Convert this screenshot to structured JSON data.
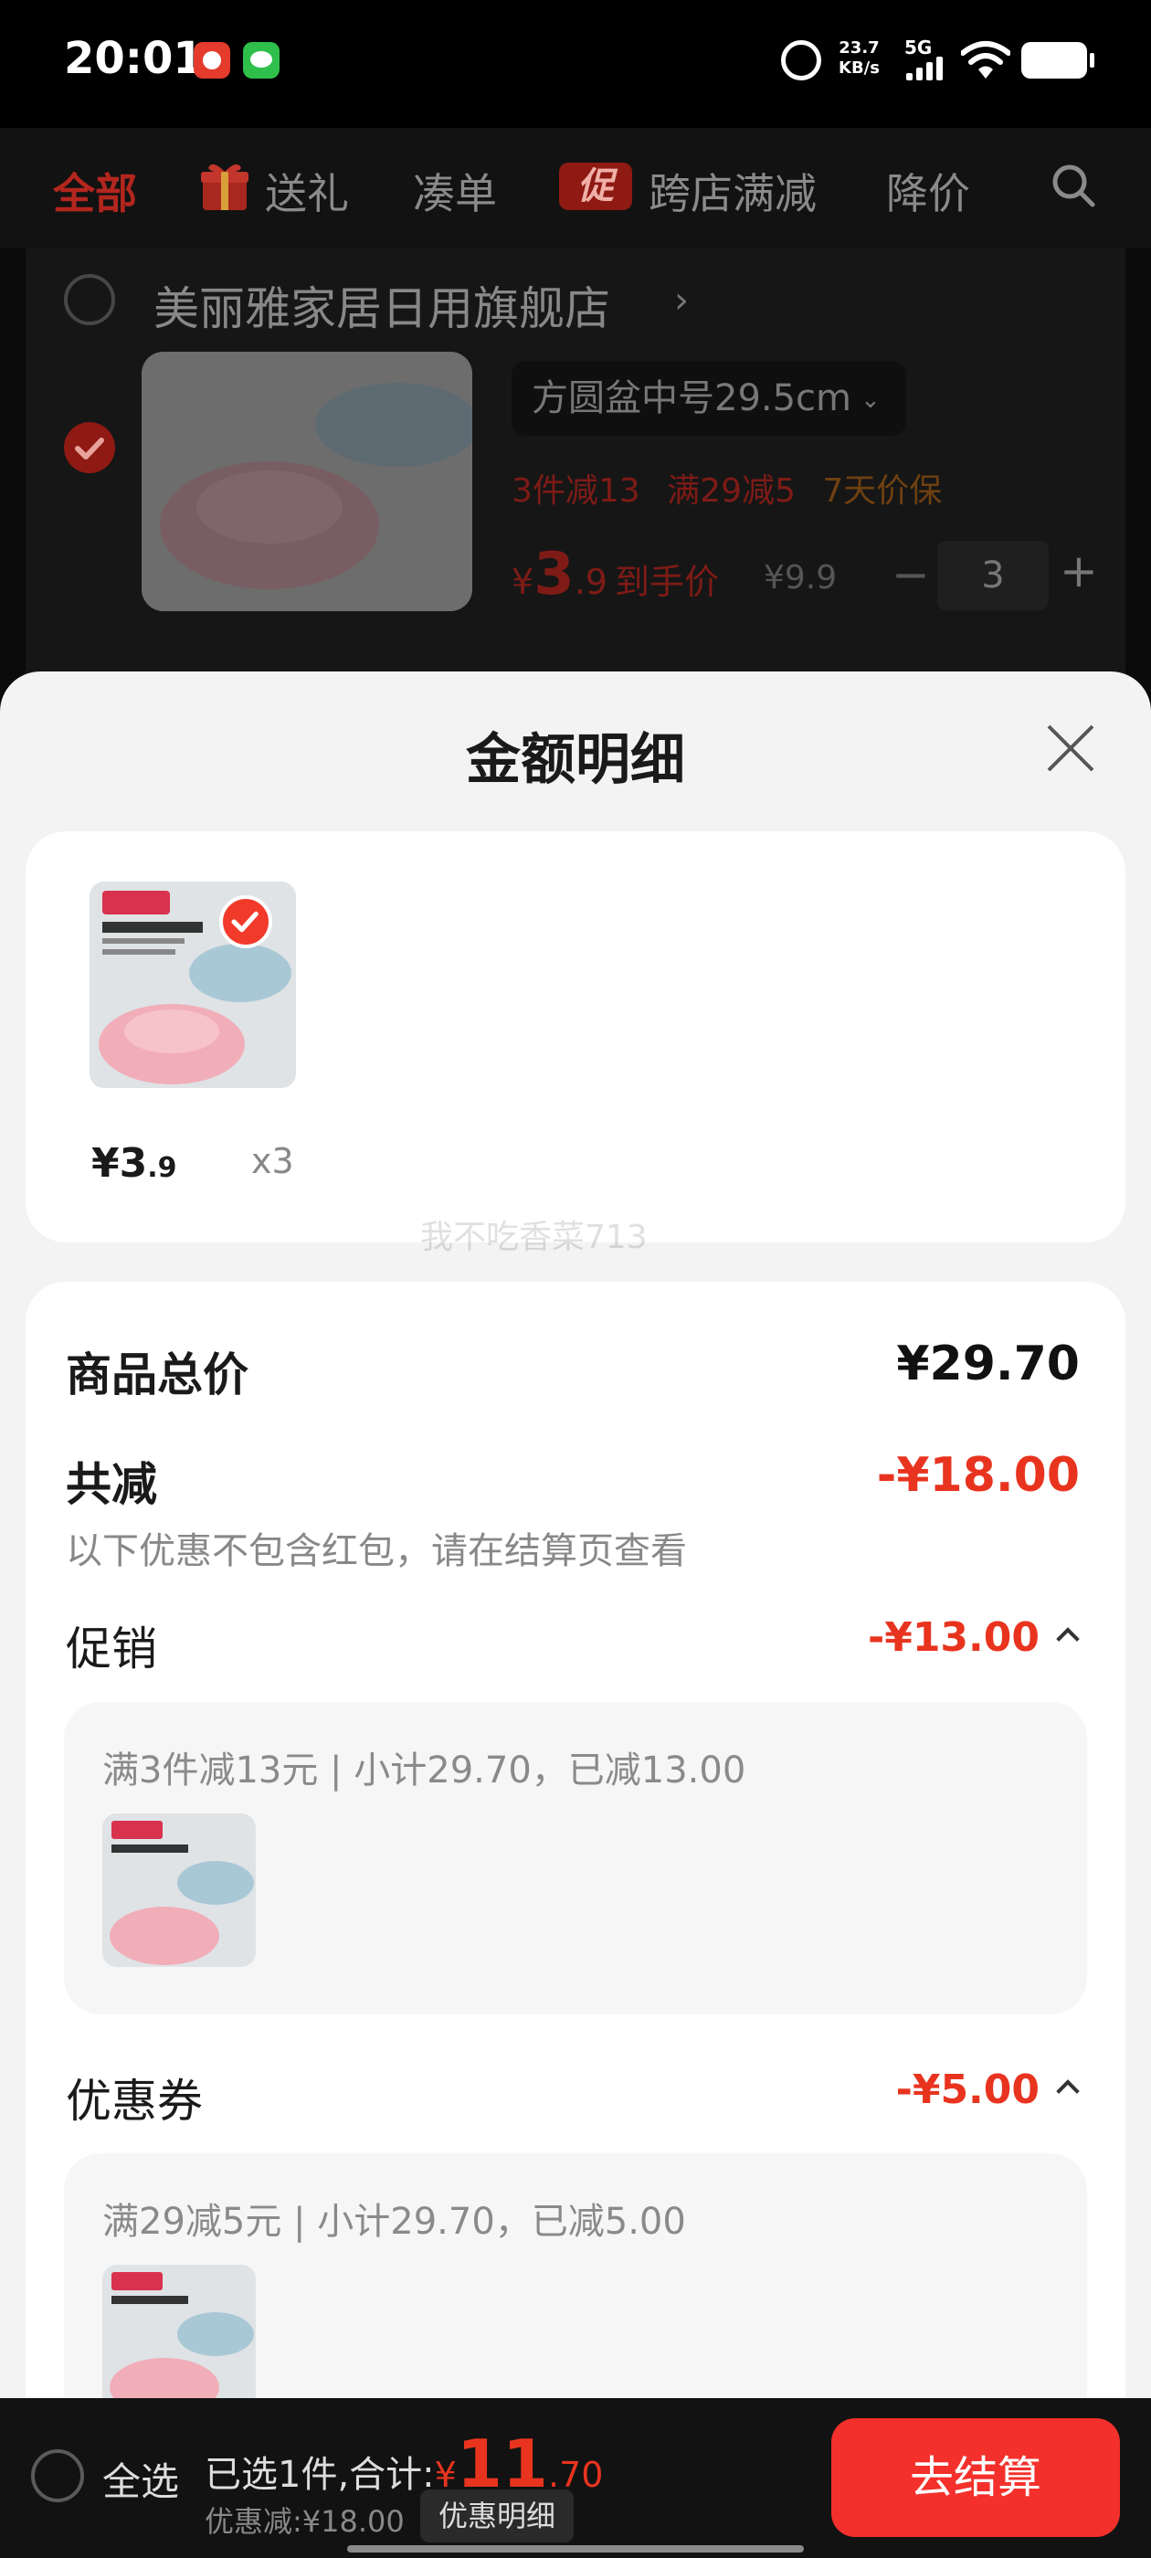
{
  "status_bar": {
    "time": "20:01",
    "net_speed_value": "23.7",
    "net_speed_unit": "KB/s",
    "network": "5G",
    "icons": [
      "app-notification-icon",
      "wechat-icon",
      "alarm-icon",
      "signal-icon",
      "wifi-icon",
      "battery-icon"
    ]
  },
  "tabs": {
    "all": "全部",
    "gift": "送礼",
    "bundle": "凑单",
    "promo_badge": "促",
    "cross_store": "跨店满减",
    "price_drop": "降价"
  },
  "cart": {
    "store_name": "美丽雅家居日用旗舰店",
    "item": {
      "variant": "方圆盆中号29.5cm",
      "tag1": "3件减13",
      "tag2": "满29减5",
      "tag3": "7天价保",
      "price_symbol": "¥",
      "price_int": "3",
      "price_dec": ".9",
      "price_label": "到手价",
      "original_price": "¥9.9",
      "quantity": "3",
      "minus": "−",
      "plus": "+"
    }
  },
  "sheet": {
    "title": "金额明细",
    "item_price_int": "¥3",
    "item_price_dec": ".9",
    "item_qty": "x3",
    "watermark": "我不吃香菜713",
    "goods_total_label": "商品总价",
    "goods_total": "¥29.70",
    "total_reduction_label": "共减",
    "total_reduction": "-¥18.00",
    "note": "以下优惠不包含红包，请在结算页查看",
    "promo_label": "促销",
    "promo_value": "-¥13.00",
    "promo_detail": "满3件减13元 | 小计29.70，已减13.00",
    "coupon_label": "优惠券",
    "coupon_value": "-¥5.00",
    "coupon_detail": "满29减5元 | 小计29.70，已减5.00"
  },
  "bottom_bar": {
    "select_all": "全选",
    "selected_label": "已选1件,合计:",
    "currency": "¥",
    "total_int": "11",
    "total_dec": ".70",
    "discount": "优惠减:¥18.00",
    "detail_button": "优惠明细",
    "checkout": "去结算"
  },
  "colors": {
    "accent_red": "#f3302b",
    "discount_red": "#e8341f",
    "sheet_bg": "#f3f3f3"
  }
}
